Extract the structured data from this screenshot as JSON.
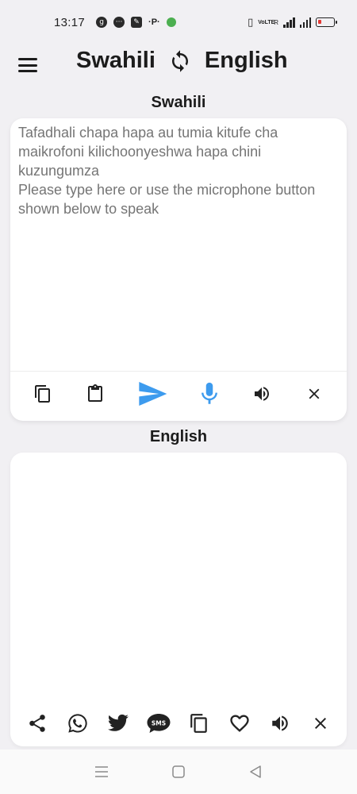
{
  "status_bar": {
    "time": "13:17",
    "notification_icons": [
      "g-icon",
      "message-icon",
      "edit-icon",
      "pay-icon",
      "circle-icon"
    ],
    "pay_label": "·P·",
    "network_label": "VoLTE",
    "signal_label": "R",
    "battery_color": "#e53935"
  },
  "app_bar": {
    "source_language": "Swahili",
    "target_language": "English"
  },
  "input_section": {
    "label": "Swahili",
    "placeholder": "Tafadhali chapa hapa au tumia kitufe cha maikrofoni kilichoonyeshwa hapa chini kuzungumza\nPlease type here or use the microphone button shown below to speak",
    "value": ""
  },
  "output_section": {
    "label": "English",
    "text": ""
  },
  "colors": {
    "accent": "#3d9bee",
    "background": "#f1f0f3",
    "card": "#ffffff",
    "text": "#1c1c1c",
    "placeholder": "#9e9e9e"
  }
}
